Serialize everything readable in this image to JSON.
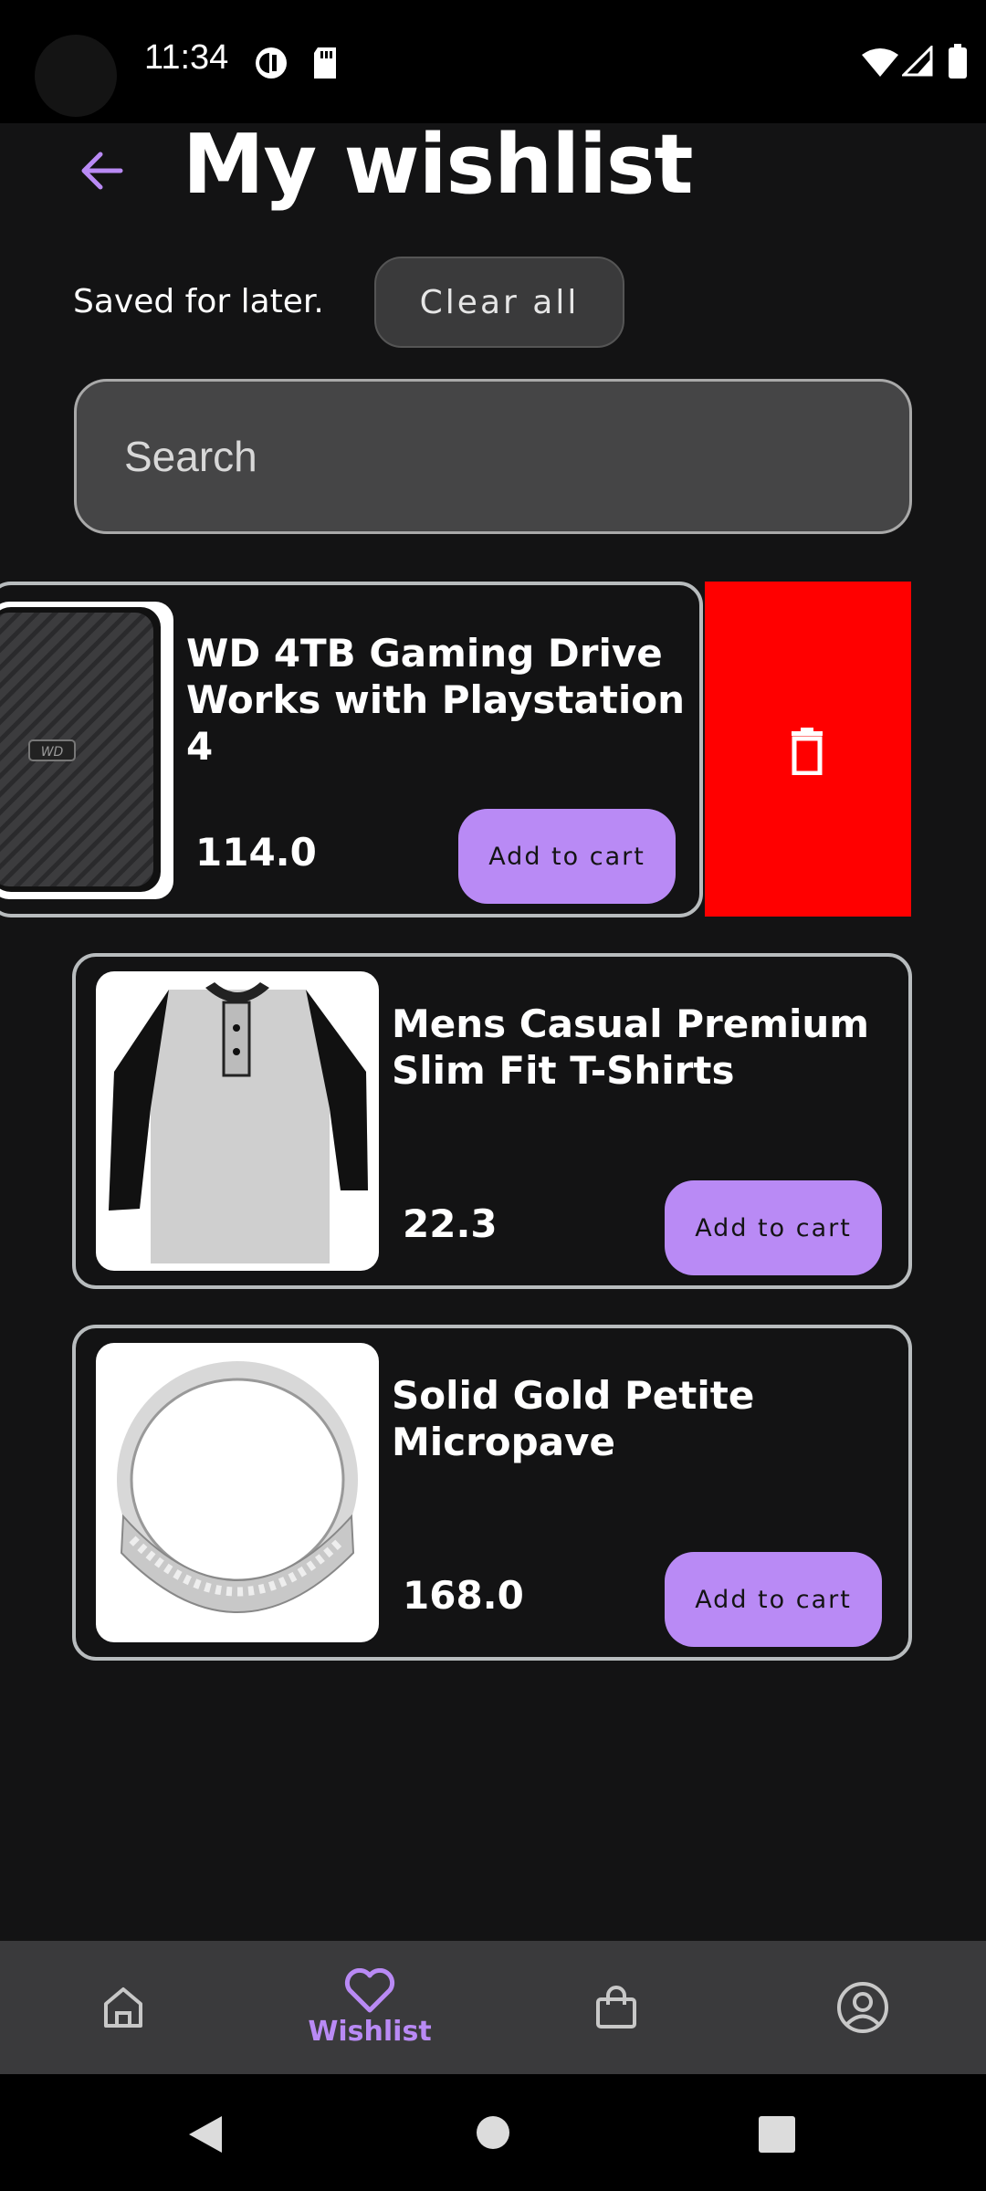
{
  "status_bar": {
    "time": "11:34"
  },
  "header": {
    "title": "My wishlist"
  },
  "subheader": {
    "saved_text": "Saved for later.",
    "clear_label": "Clear all"
  },
  "search": {
    "placeholder": "Search"
  },
  "colors": {
    "accent": "#b98af5",
    "delete": "#ff0000",
    "background": "#131314"
  },
  "items": [
    {
      "name_line1": "WD 4TB Gaming Drive",
      "name_line2": "Works with Playstation 4",
      "price": "114.0",
      "cart_label": "Add to cart"
    },
    {
      "name_line1": "Mens Casual Premium",
      "name_line2": "Slim Fit T-Shirts",
      "price": "22.3",
      "cart_label": "Add to cart"
    },
    {
      "name_line1": "Solid Gold Petite",
      "name_line2": "Micropave",
      "price": "168.0",
      "cart_label": "Add to cart"
    }
  ],
  "bottom_nav": {
    "items": [
      {
        "icon": "home-icon"
      },
      {
        "icon": "heart-icon",
        "label": "Wishlist",
        "selected": true
      },
      {
        "icon": "shopping-bag-icon"
      },
      {
        "icon": "account-icon"
      }
    ]
  }
}
